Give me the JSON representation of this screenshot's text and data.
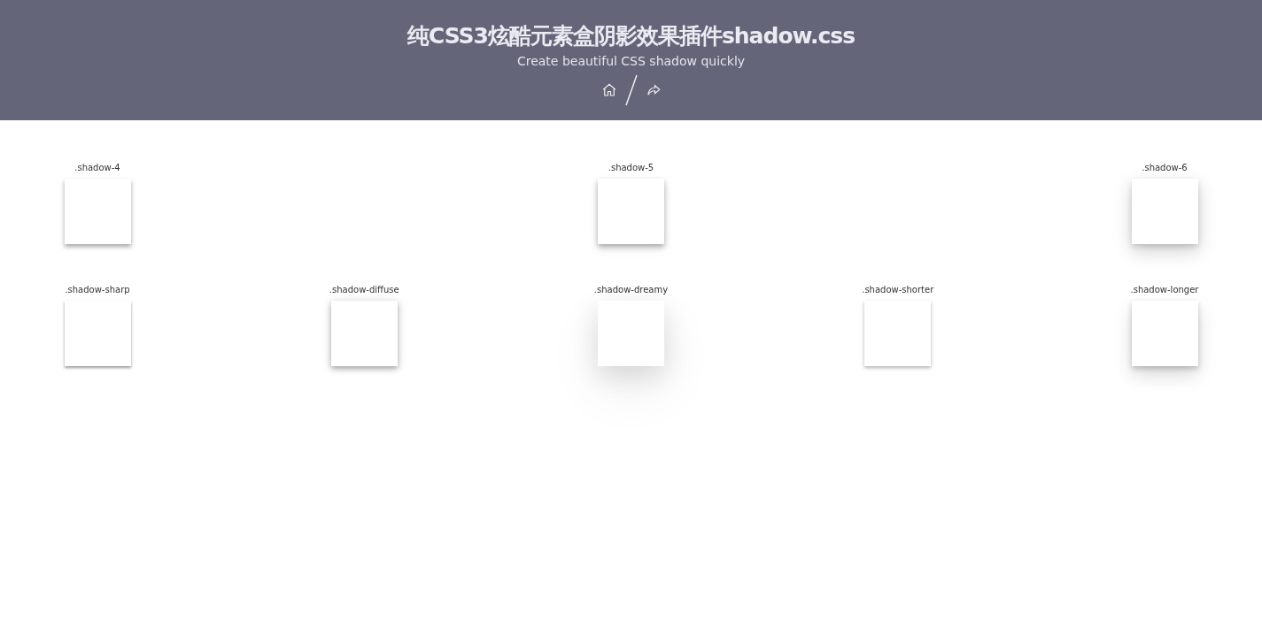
{
  "header": {
    "title": "纯CSS3炫酷元素盒阴影效果插件shadow.css",
    "subtitle": "Create beautiful CSS shadow quickly"
  },
  "rows": [
    [
      {
        "label": ".shadow-4",
        "kind": "s4"
      },
      {
        "label": ".shadow-5",
        "kind": "s5"
      },
      {
        "label": ".shadow-6",
        "kind": "s6"
      }
    ],
    [
      {
        "label": ".shadow-sharp",
        "kind": "sharp"
      },
      {
        "label": ".shadow-diffuse",
        "kind": "diffuse"
      },
      {
        "label": ".shadow-dreamy",
        "kind": "dreamy"
      },
      {
        "label": ".shadow-shorter",
        "kind": "shorter"
      },
      {
        "label": ".shadow-longer",
        "kind": "longer"
      }
    ]
  ]
}
